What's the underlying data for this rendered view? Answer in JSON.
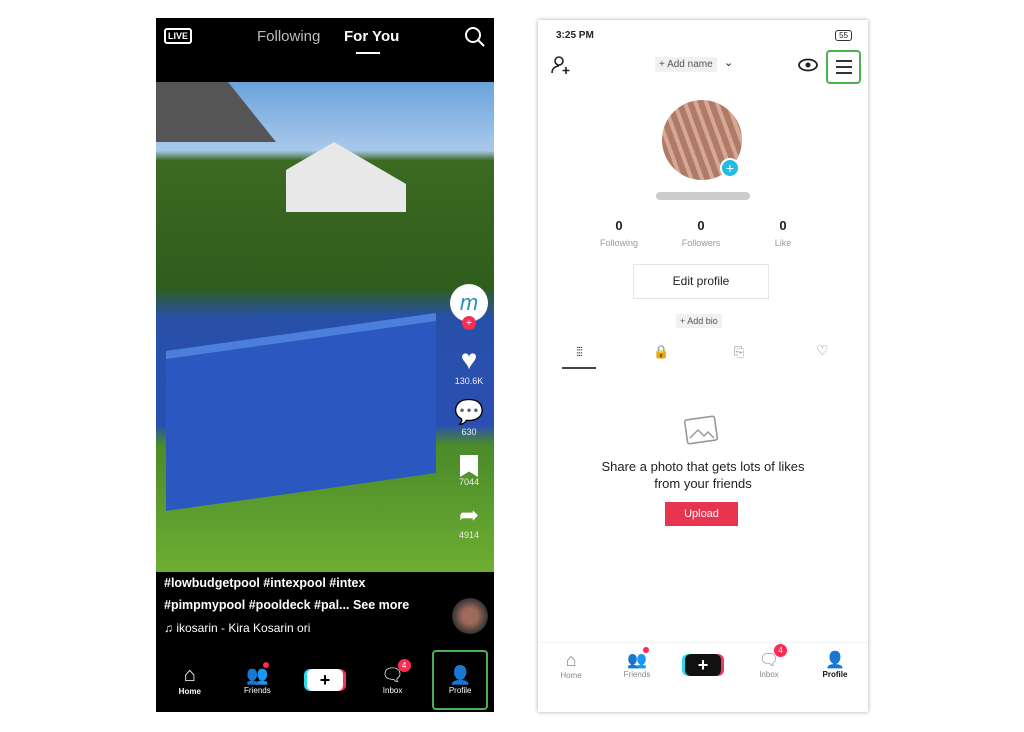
{
  "feed": {
    "live_label": "LIVE",
    "tabs": [
      "Following",
      "For You"
    ],
    "active_tab": "For You",
    "rail": {
      "likes": "130.6K",
      "comments": "630",
      "saves": "7044",
      "shares": "4914"
    },
    "caption_line1": "#lowbudgetpool #intexpool #intex",
    "caption_line2": "#pimpmypool #pooldeck #pal...",
    "see_more": "See more",
    "sound": "ikosarin - Kira Kosarin    ori",
    "nav": [
      {
        "label": "Home"
      },
      {
        "label": "Friends"
      },
      {
        "label": "+"
      },
      {
        "label": "Inbox",
        "badge": "4"
      },
      {
        "label": "Profile"
      }
    ]
  },
  "profile": {
    "status_time": "3:25 PM",
    "battery": "55",
    "add_name": "+ Add name",
    "stats": [
      {
        "value": "0",
        "label": "Following"
      },
      {
        "value": "0",
        "label": "Followers"
      },
      {
        "value": "0",
        "label": "Like"
      }
    ],
    "edit_profile": "Edit profile",
    "add_bio": "+ Add bio",
    "empty_text": "Share a photo that gets lots of likes from your friends",
    "upload": "Upload",
    "nav": [
      {
        "label": "Home"
      },
      {
        "label": "Friends"
      },
      {
        "label": "+"
      },
      {
        "label": "Inbox",
        "badge": "4"
      },
      {
        "label": "Profile"
      }
    ]
  },
  "colors": {
    "accent": "#fe2c55",
    "highlight": "#4caf50",
    "upload": "#e8354f"
  }
}
